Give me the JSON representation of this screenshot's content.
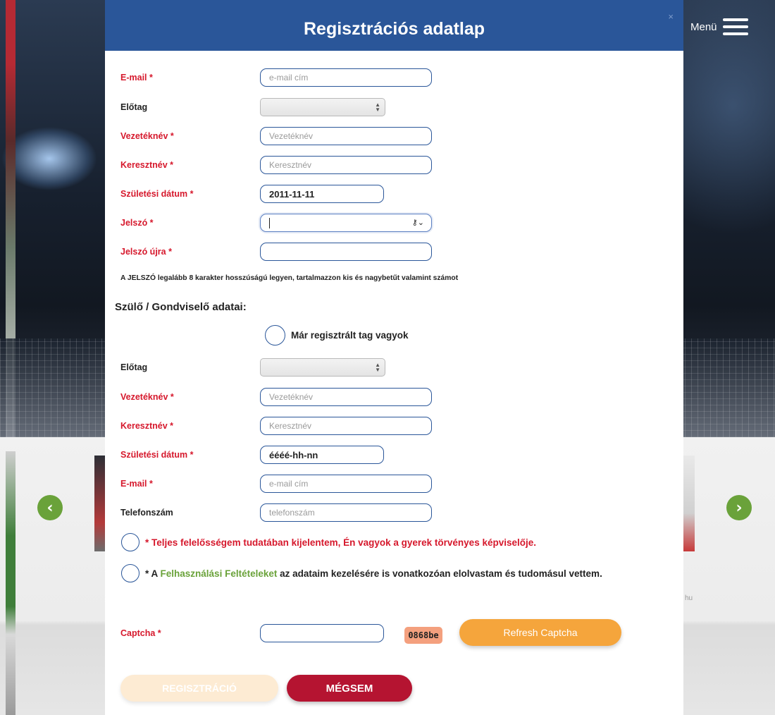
{
  "header": {
    "title": "Regisztrációs adatlap",
    "close_label": "×"
  },
  "menu": {
    "label": "Menü"
  },
  "background": {
    "slider_prev": "‹",
    "slider_next": "›",
    "url_fragment": "hu"
  },
  "form": {
    "email": {
      "label": "E-mail *",
      "placeholder": "e-mail cím"
    },
    "prefix": {
      "label": "Előtag"
    },
    "last_name": {
      "label": "Vezetéknév *",
      "placeholder": "Vezetéknév"
    },
    "first_name": {
      "label": "Keresztnév *",
      "placeholder": "Keresztnév"
    },
    "birth_date": {
      "label": "Születési dátum *",
      "value": "2011-11-11"
    },
    "password": {
      "label": "Jelszó *"
    },
    "password_again": {
      "label": "Jelszó újra *"
    },
    "password_hint": "A JELSZÓ legalább 8 karakter hosszúságú legyen, tartalmazzon kis és nagybetűt valamint számot"
  },
  "guardian": {
    "section_title": "Szülő / Gondviselő adatai:",
    "already_member": "Már regisztrált tag vagyok",
    "prefix": {
      "label": "Előtag"
    },
    "last_name": {
      "label": "Vezetéknév *",
      "placeholder": "Vezetéknév"
    },
    "first_name": {
      "label": "Keresztnév *",
      "placeholder": "Keresztnév"
    },
    "birth_date": {
      "label": "Születési dátum *",
      "value": "éééé-hh-nn"
    },
    "email": {
      "label": "E-mail *",
      "placeholder": "e-mail cím"
    },
    "phone": {
      "label": "Telefonszám",
      "placeholder": "telefonszám"
    }
  },
  "consents": {
    "responsibility": "* Teljes felelősségem tudatában kijelentem, Én vagyok a gyerek törvényes képviselője.",
    "terms_prefix": "* A",
    "terms_link": "Felhasználási Feltételeket",
    "terms_suffix": "az adataim kezelésére is vonatkozóan elolvastam és tudomásul vettem."
  },
  "captcha": {
    "label": "Captcha *",
    "code": "0868be",
    "refresh_label": "Refresh Captcha"
  },
  "buttons": {
    "register": "REGISZTRÁCIÓ",
    "cancel": "MÉGSEM"
  },
  "colors": {
    "header_blue": "#2a5699",
    "required_red": "#d6182c",
    "link_green": "#6aa23a",
    "refresh_orange": "#f5a53c",
    "cancel_red": "#b51431",
    "register_disabled": "#fdebd3"
  }
}
